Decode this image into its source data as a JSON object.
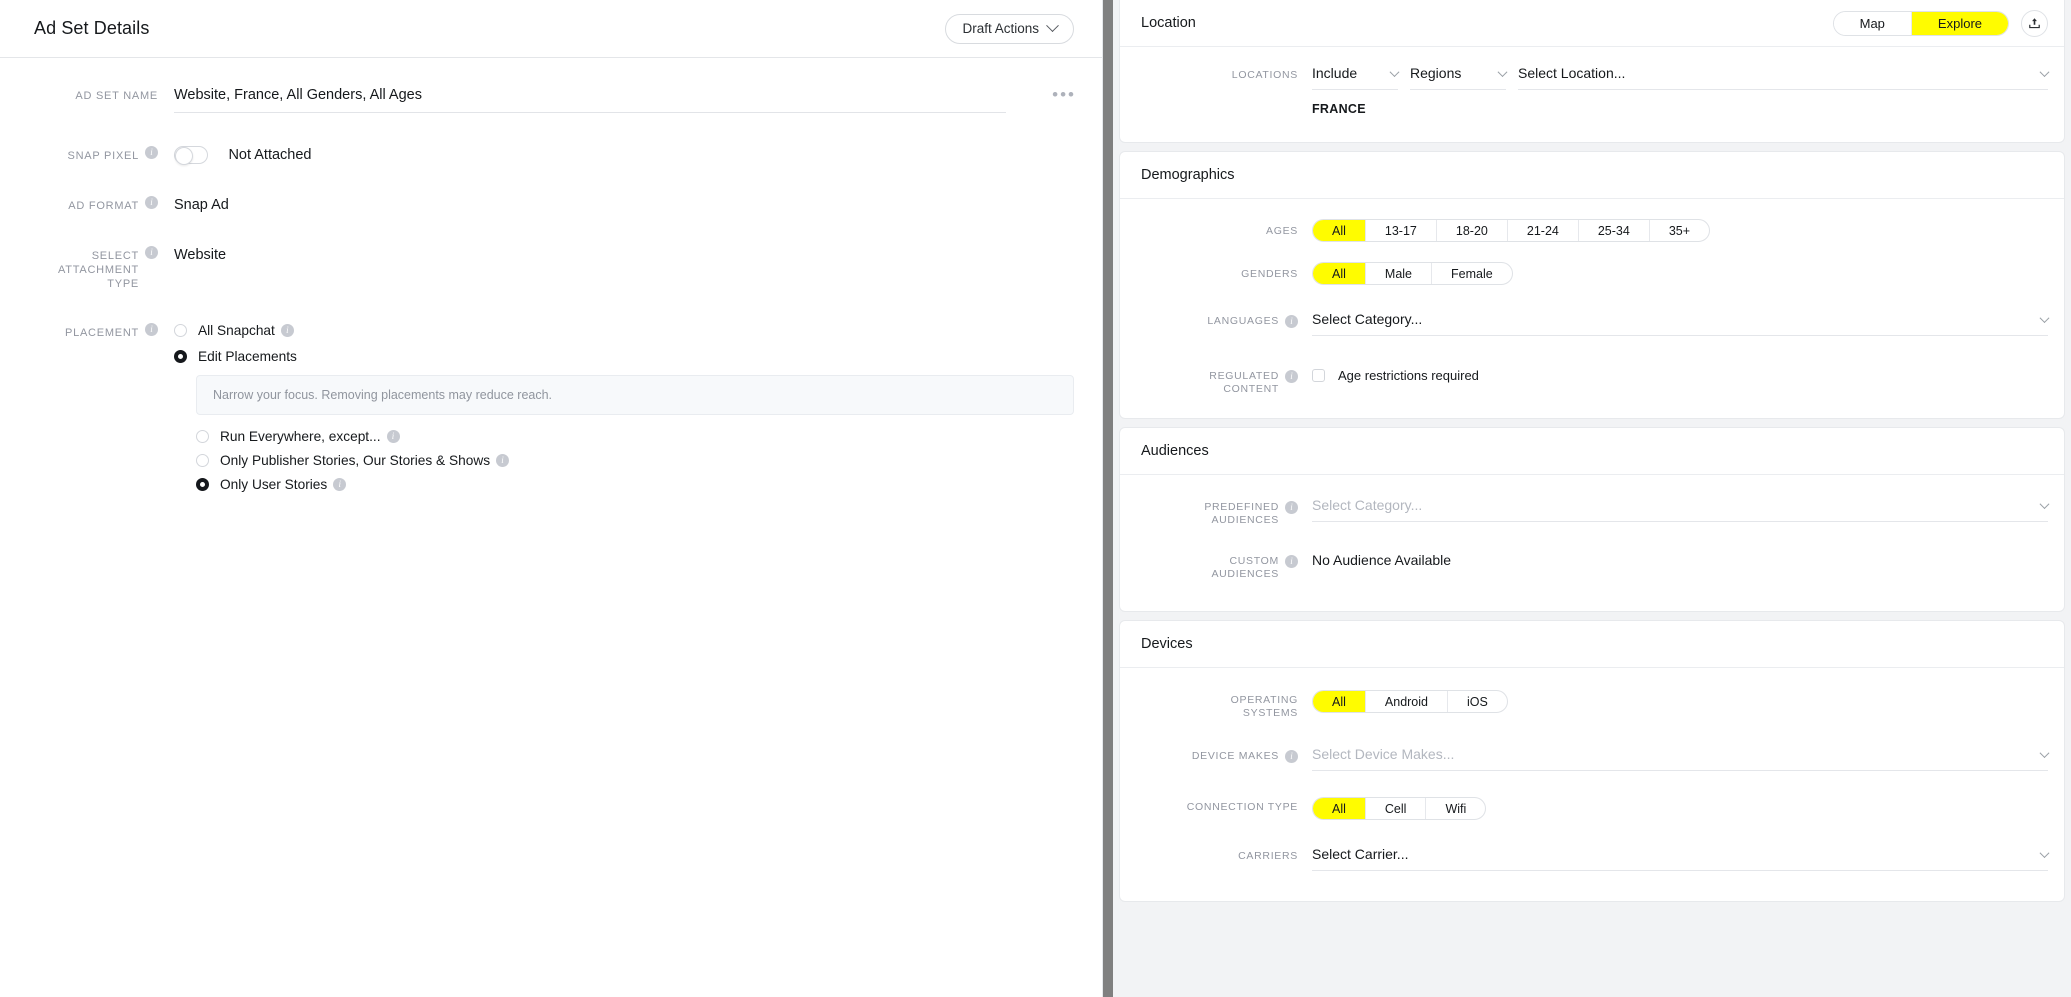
{
  "left": {
    "header": {
      "title": "Ad Set Details",
      "draft_actions_label": "Draft Actions"
    },
    "fields": {
      "ad_set_name_label": "AD SET NAME",
      "ad_set_name_value": "Website, France, All Genders, All Ages",
      "snap_pixel_label": "SNAP PIXEL",
      "snap_pixel_value": "Not Attached",
      "ad_format_label": "AD FORMAT",
      "ad_format_value": "Snap Ad",
      "attachment_label": "SELECT ATTACHMENT TYPE",
      "attachment_value": "Website",
      "placement_label": "PLACEMENT"
    },
    "placement": {
      "all_snapchat": "All Snapchat",
      "edit_placements": "Edit Placements",
      "hint": "Narrow your focus. Removing placements may reduce reach.",
      "options": [
        {
          "label": "Run Everywhere, except...",
          "checked": false,
          "info": true
        },
        {
          "label": "Only Publisher Stories, Our Stories & Shows",
          "checked": false,
          "info": true
        },
        {
          "label": "Only User Stories",
          "checked": true,
          "info": true
        }
      ]
    }
  },
  "right": {
    "location": {
      "title": "Location",
      "map_label": "Map",
      "explore_label": "Explore",
      "locations_label": "LOCATIONS",
      "include_value": "Include",
      "regions_value": "Regions",
      "select_location_placeholder": "Select Location...",
      "selected_tag": "FRANCE"
    },
    "demographics": {
      "title": "Demographics",
      "ages_label": "AGES",
      "ages_options": [
        "All",
        "13-17",
        "18-20",
        "21-24",
        "25-34",
        "35+"
      ],
      "ages_selected": "All",
      "genders_label": "GENDERS",
      "genders_options": [
        "All",
        "Male",
        "Female"
      ],
      "genders_selected": "All",
      "languages_label": "LANGUAGES",
      "languages_value": "Select Category...",
      "regulated_label": "REGULATED CONTENT",
      "regulated_checkbox_label": "Age restrictions required"
    },
    "audiences": {
      "title": "Audiences",
      "predefined_label": "PREDEFINED AUDIENCES",
      "predefined_placeholder": "Select Category...",
      "custom_label": "CUSTOM AUDIENCES",
      "custom_value": "No Audience Available"
    },
    "devices": {
      "title": "Devices",
      "os_label": "OPERATING SYSTEMS",
      "os_options": [
        "All",
        "Android",
        "iOS"
      ],
      "os_selected": "All",
      "device_makes_label": "DEVICE MAKES",
      "device_makes_placeholder": "Select Device Makes...",
      "connection_label": "CONNECTION TYPE",
      "connection_options": [
        "All",
        "Cell",
        "Wifi"
      ],
      "connection_selected": "All",
      "carriers_label": "CARRIERS",
      "carriers_placeholder": "Select Carrier..."
    }
  },
  "colors": {
    "accent_yellow": "#FFFC00",
    "text_primary": "#16191c",
    "label_gray": "#9296a0",
    "panel_bg": "#f2f3f5"
  }
}
